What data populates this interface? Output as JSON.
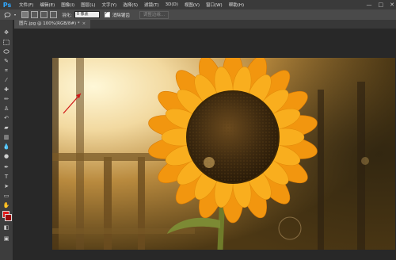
{
  "app": {
    "logo": "Ps"
  },
  "menu": [
    "文件(F)",
    "编辑(E)",
    "图像(I)",
    "图层(L)",
    "文字(Y)",
    "选择(S)",
    "滤镜(T)",
    "3D(D)",
    "视图(V)",
    "窗口(W)",
    "帮助(H)"
  ],
  "window_controls": {
    "minimize": "—",
    "maximize": "□",
    "close": "✕"
  },
  "options_bar": {
    "feather_label": "羽化:",
    "feather_value": "0 像素",
    "antialias_label": "消除锯齿",
    "refine_edge_label": "调整边缘..."
  },
  "document_tab": {
    "title": "图片.jpg @ 100%(RGB/8#) *",
    "close": "×"
  },
  "colors": {
    "foreground": "#e11b1b",
    "background": "#9a0d0d",
    "arrow": "#d01818"
  },
  "tools": [
    "move-icon",
    "marquee-icon",
    "lasso-icon",
    "quick-select-icon",
    "crop-icon",
    "eyedropper-icon",
    "healing-icon",
    "brush-icon",
    "clone-stamp-icon",
    "history-brush-icon",
    "eraser-icon",
    "gradient-icon",
    "blur-icon",
    "dodge-icon",
    "pen-icon",
    "type-icon",
    "path-select-icon",
    "shape-icon",
    "hand-icon",
    "zoom-icon"
  ]
}
